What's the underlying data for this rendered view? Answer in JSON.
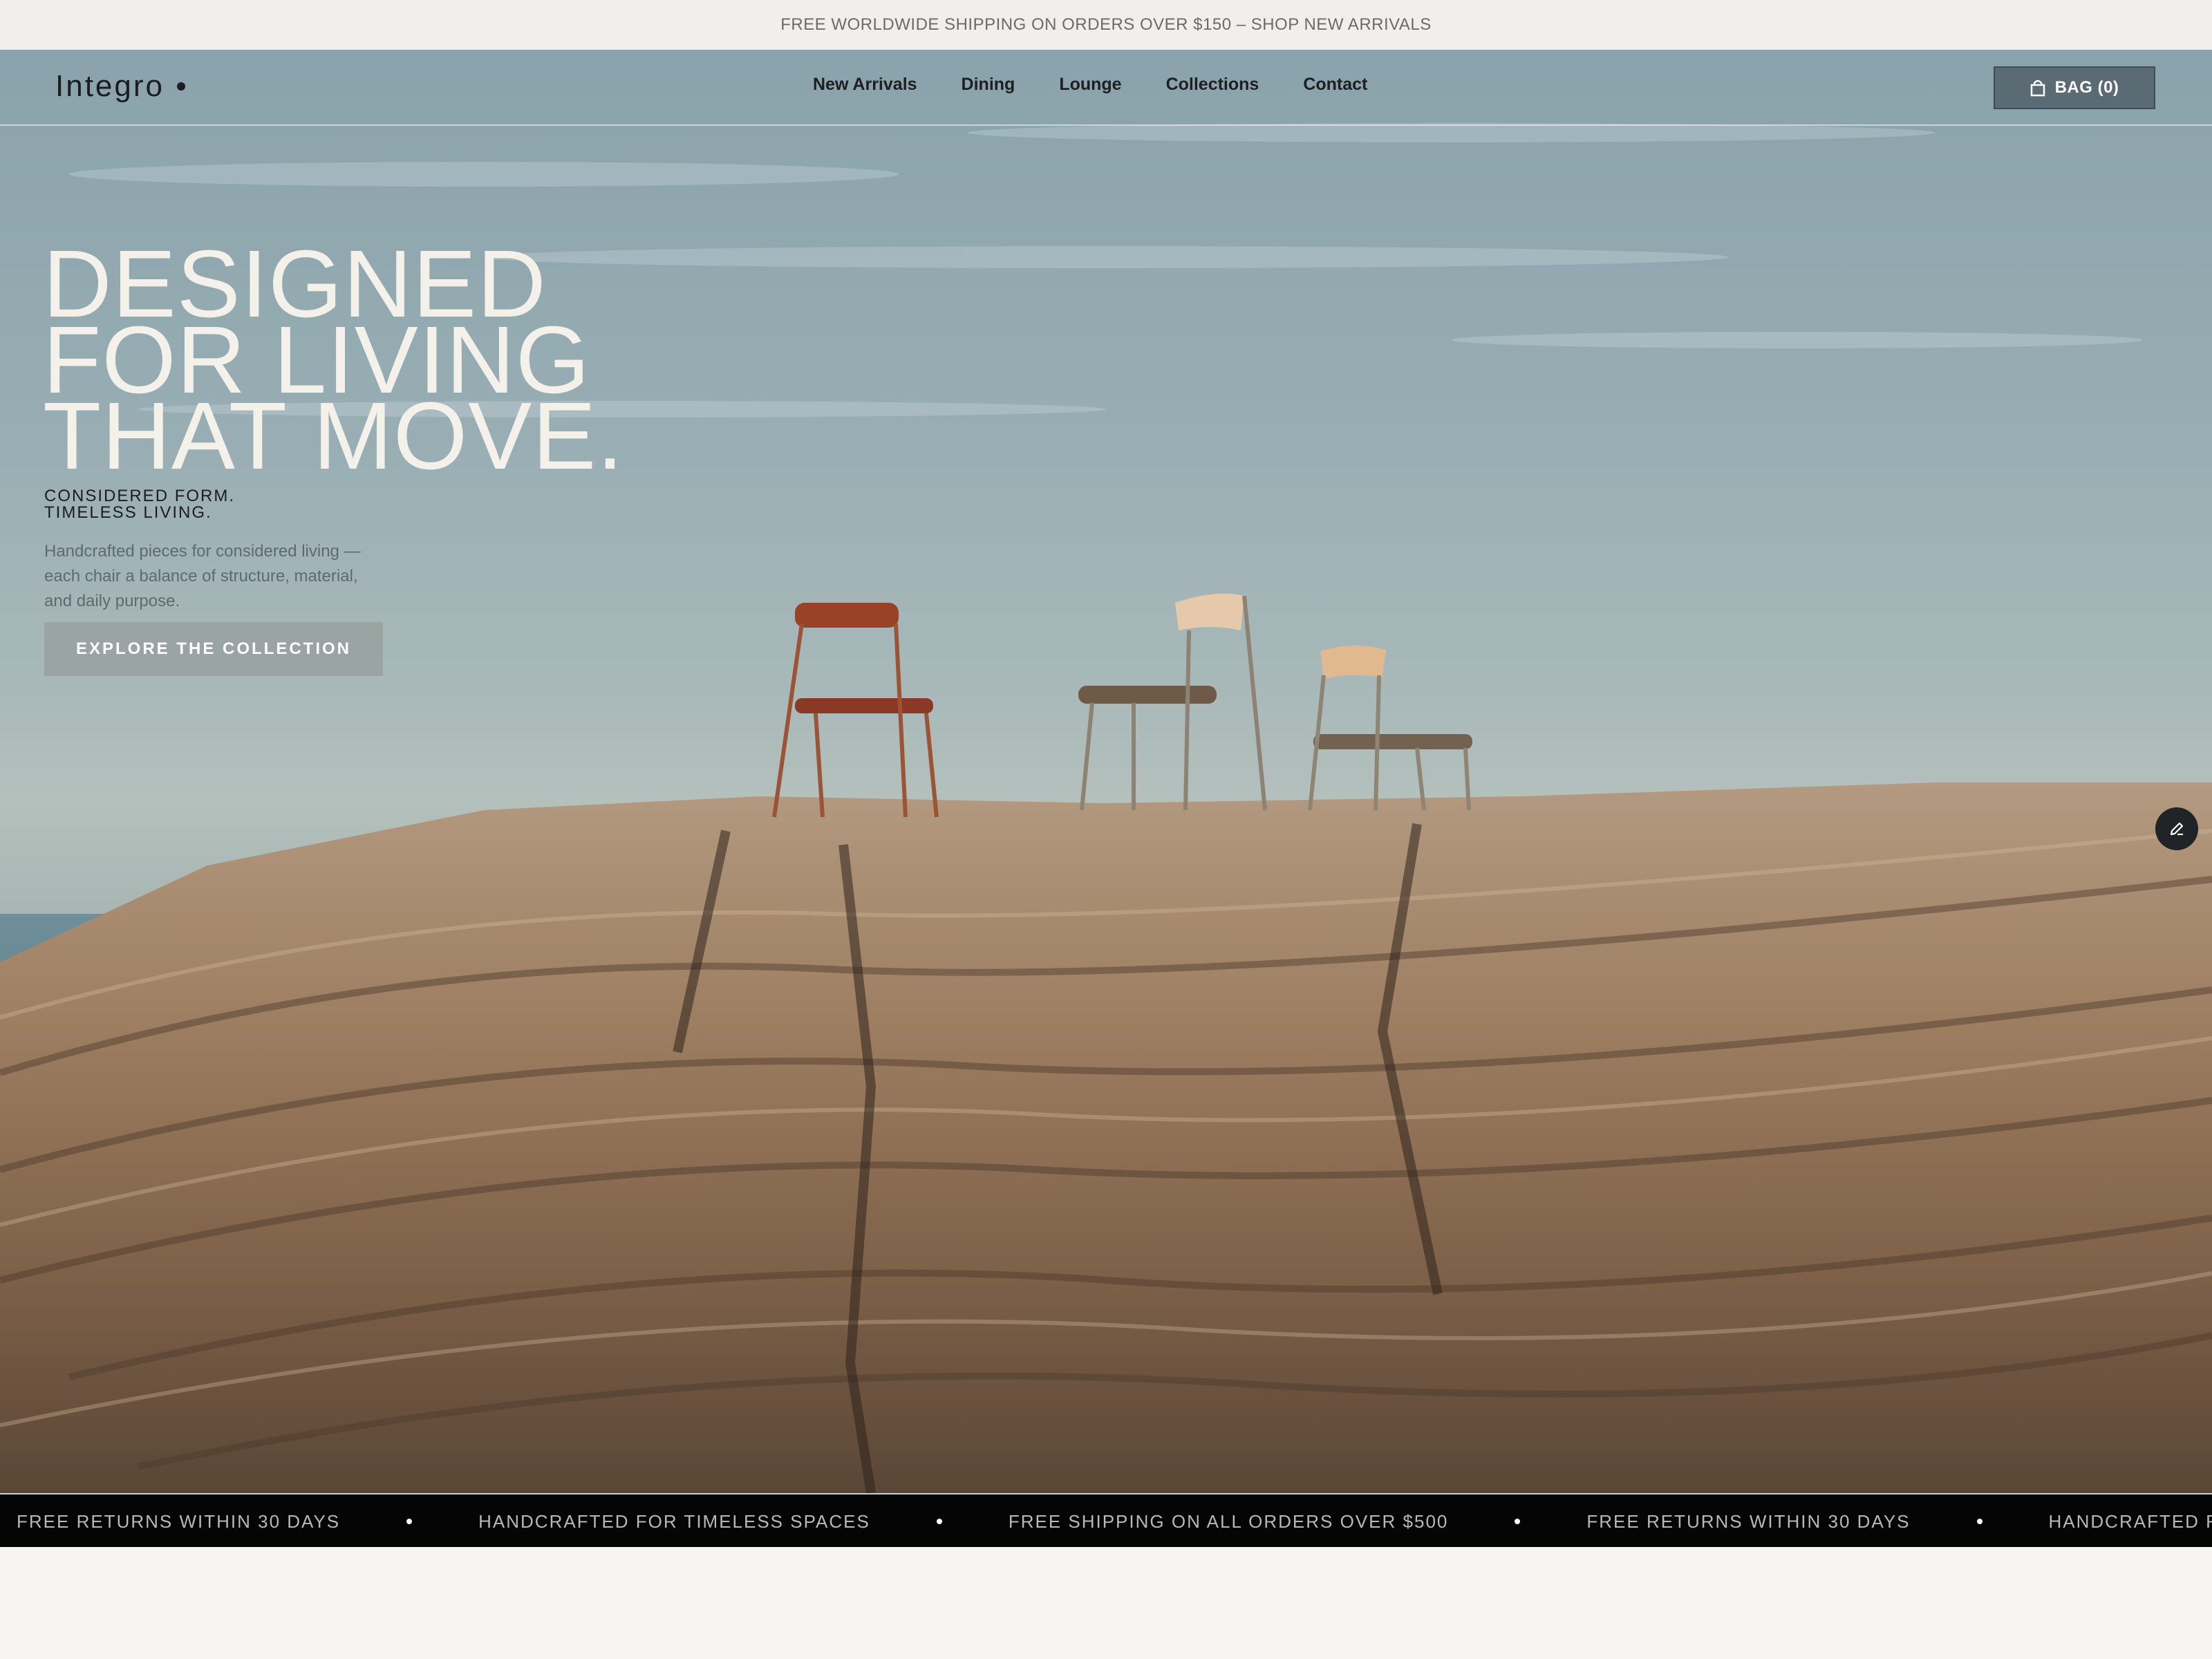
{
  "announcement": {
    "text": "FREE WORLDWIDE SHIPPING ON ORDERS OVER $150 – SHOP NEW ARRIVALS"
  },
  "header": {
    "logo": "Integro",
    "nav": [
      "New Arrivals",
      "Dining",
      "Lounge",
      "Collections",
      "Contact"
    ],
    "bag_label": "BAG (0)",
    "bag_icon": "bag-icon"
  },
  "hero": {
    "headline": [
      "DESIGNED",
      "FOR LIVING",
      "THAT MOVE."
    ],
    "tagline": [
      "CONSIDERED FORM.",
      "TIMELESS LIVING."
    ],
    "description": "Handcrafted pieces for considered living — each chair a balance of structure, material, and daily purpose.",
    "cta_label": "EXPLORE THE COLLECTION",
    "edit_icon": "pencil-icon"
  },
  "ticker": {
    "items": [
      "FREE RETURNS WITHIN 30 DAYS",
      "HANDCRAFTED FOR TIMELESS SPACES",
      "FREE SHIPPING ON ALL ORDERS OVER $500",
      "FREE RETURNS WITHIN 30 DAYS",
      "HANDCRAFTED FOR TIMELESS SPACES"
    ]
  },
  "colors": {
    "announcement_bg": "#f0efeb",
    "ticker_bg": "#050505",
    "cta_bg": "#9aa5a3",
    "bag_bg": "#5a6b74",
    "headline": "#f3f1ea"
  }
}
